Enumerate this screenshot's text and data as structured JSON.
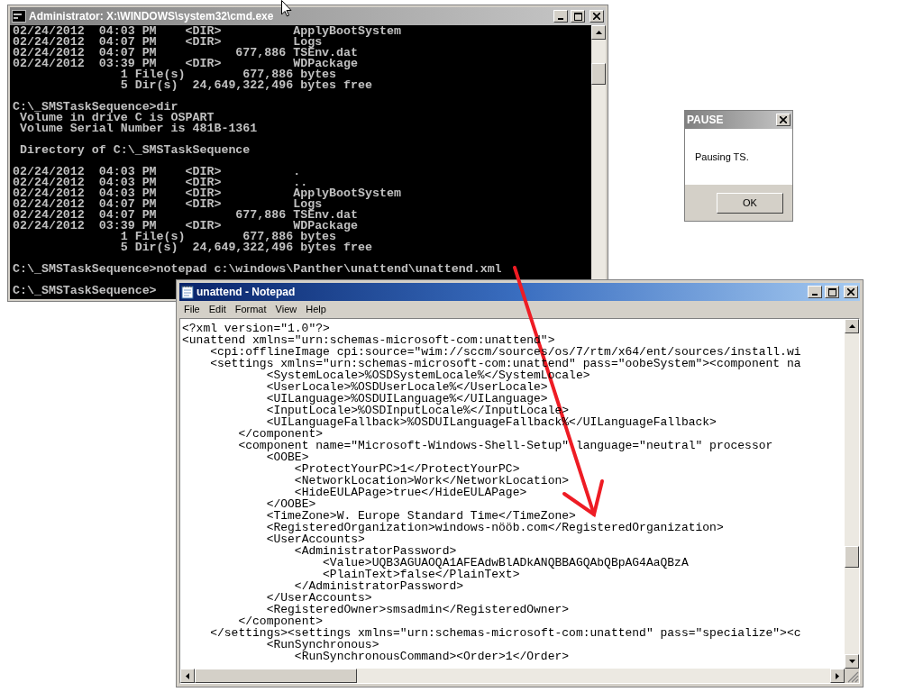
{
  "cmd_window": {
    "title": "Administrator: X:\\WINDOWS\\system32\\cmd.exe",
    "active": false,
    "blocks": [
      [
        "02/24/2012  04:03 PM    <DIR>          ApplyBootSystem",
        "02/24/2012  04:07 PM    <DIR>          Logs",
        "02/24/2012  04:07 PM           677,886 TSEnv.dat",
        "02/24/2012  03:39 PM    <DIR>          WDPackage",
        "               1 File(s)        677,886 bytes",
        "               5 Dir(s)  24,649,322,496 bytes free"
      ],
      [
        "C:\\_SMSTaskSequence>dir",
        " Volume in drive C is OSPART",
        " Volume Serial Number is 481B-1361"
      ],
      [
        " Directory of C:\\_SMSTaskSequence"
      ],
      [
        "02/24/2012  04:03 PM    <DIR>          .",
        "02/24/2012  04:03 PM    <DIR>          ..",
        "02/24/2012  04:03 PM    <DIR>          ApplyBootSystem",
        "02/24/2012  04:07 PM    <DIR>          Logs",
        "02/24/2012  04:07 PM           677,886 TSEnv.dat",
        "02/24/2012  03:39 PM    <DIR>          WDPackage",
        "               1 File(s)        677,886 bytes",
        "               5 Dir(s)  24,649,322,496 bytes free"
      ],
      [
        "C:\\_SMSTaskSequence>notepad c:\\windows\\Panther\\unattend\\unattend.xml"
      ],
      [
        "C:\\_SMSTaskSequence>"
      ]
    ]
  },
  "pause_dialog": {
    "title": "PAUSE",
    "active": false,
    "message": "Pausing TS.",
    "buttons": [
      "OK"
    ]
  },
  "notepad": {
    "title": "unattend - Notepad",
    "active": true,
    "menu": [
      "File",
      "Edit",
      "Format",
      "View",
      "Help"
    ],
    "lines": [
      "<?xml version=\"1.0\"?>",
      "<unattend xmlns=\"urn:schemas-microsoft-com:unattend\">",
      "\t<cpi:offlineImage cpi:source=\"wim://sccm/sources/os/7/rtm/x64/ent/sources/install.wi",
      "\t<settings xmlns=\"urn:schemas-microsoft-com:unattend\" pass=\"oobeSystem\"><component na",
      "\t\t\t<SystemLocale>%OSDSystemLocale%</SystemLocale>",
      "\t\t\t<UserLocale>%OSDUserLocale%</UserLocale>",
      "\t\t\t<UILanguage>%OSDUILanguage%</UILanguage>",
      "\t\t\t<InputLocale>%OSDInputLocale%</InputLocale>",
      "\t\t\t<UILanguageFallback>%OSDUILanguageFallback%</UILanguageFallback>",
      "\t\t</component>",
      "\t\t<component name=\"Microsoft-Windows-Shell-Setup\" language=\"neutral\" processor",
      "\t\t\t<OOBE>",
      "\t\t\t\t<ProtectYourPC>1</ProtectYourPC>",
      "\t\t\t\t<NetworkLocation>Work</NetworkLocation>",
      "\t\t\t\t<HideEULAPage>true</HideEULAPage>",
      "\t\t\t</OOBE>",
      "\t\t\t<TimeZone>W. Europe Standard Time</TimeZone>",
      "\t\t\t<RegisteredOrganization>windows-nööb.com</RegisteredOrganization>",
      "\t\t\t<UserAccounts>",
      "\t\t\t\t<AdministratorPassword>",
      "\t\t\t\t\t<Value>UQB3AGUAOQA1AFEAdwBlADkANQBBAGQAbQBpAG4AaQBzA",
      "\t\t\t\t\t<PlainText>false</PlainText>",
      "\t\t\t\t</AdministratorPassword>",
      "\t\t\t</UserAccounts>",
      "\t\t\t<RegisteredOwner>smsadmin</RegisteredOwner>",
      "\t\t</component>",
      "\t</settings><settings xmlns=\"urn:schemas-microsoft-com:unattend\" pass=\"specialize\"><c",
      "\t\t\t<RunSynchronous>",
      "\t\t\t\t<RunSynchronousCommand><Order>1</Order>"
    ]
  }
}
